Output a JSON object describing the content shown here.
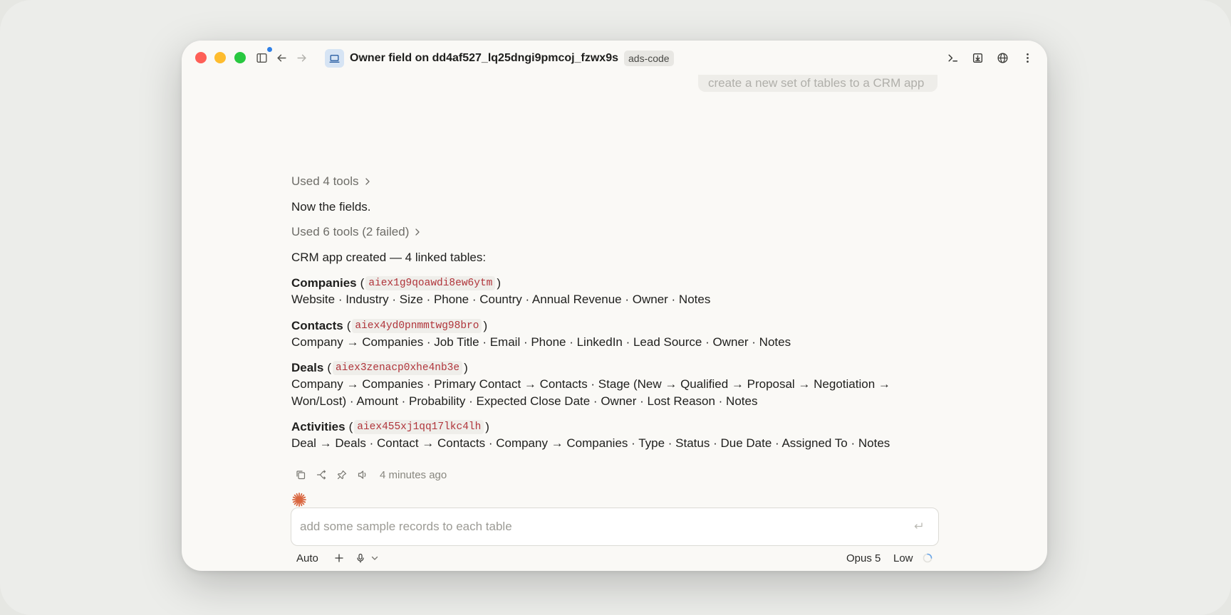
{
  "window": {
    "title": "Owner field on dd4af527_lq25dngi9pmcoj_fzwx9s",
    "badge": "ads-code"
  },
  "conversation": {
    "user_message": "create a new set of tables to a CRM app",
    "tools_used_1": "Used 4 tools",
    "line_fields": "Now the fields.",
    "tools_used_2": "Used 6 tools (2 failed)",
    "summary": "CRM app created — 4 linked tables:",
    "tables": [
      {
        "name": "Companies",
        "open": "(",
        "id": "aiex1g9qoawdi8ew6ytm",
        "close": ")",
        "fields": "Website · Industry · Size · Phone · Country · Annual Revenue · Owner · Notes"
      },
      {
        "name": "Contacts",
        "open": "(",
        "id": "aiex4yd0pnmmtwg98bro",
        "close": ")",
        "fields": "Company → Companies · Job Title · Email · Phone · LinkedIn · Lead Source · Owner · Notes"
      },
      {
        "name": "Deals",
        "open": "(",
        "id": "aiex3zenacp0xhe4nb3e",
        "close": ")",
        "fields": "Company → Companies · Primary Contact → Contacts · Stage (New → Qualified → Proposal → Negotiation → Won/Lost) · Amount · Probability · Expected Close Date · Owner · Lost Reason · Notes"
      },
      {
        "name": "Activities",
        "open": "(",
        "id": "aiex455xj1qq17lkc4lh",
        "close": ")",
        "fields": "Deal → Deals · Contact → Contacts · Company → Companies · Type · Status · Due Date · Assigned To · Notes"
      }
    ],
    "timestamp": "4 minutes ago"
  },
  "composer": {
    "placeholder": "add some sample records to each table",
    "mode": "Auto",
    "model": "Opus 5",
    "effort": "Low"
  },
  "icons": {
    "sidebar": "sidebar-icon",
    "back": "arrow-left-icon",
    "forward": "arrow-right-icon",
    "laptop": "laptop-icon",
    "terminal": "terminal-icon",
    "download": "download-icon",
    "globe": "globe-icon",
    "more": "more-vertical-icon",
    "copy": "copy-icon",
    "branch": "branch-icon",
    "pin": "pin-icon",
    "speaker": "speaker-icon",
    "spark": "spark-icon",
    "enter": "enter-icon",
    "plus": "plus-icon",
    "mic": "mic-icon",
    "chevron": "chevron-down-icon",
    "spinner": "spinner-icon"
  },
  "colors": {
    "accent_spark": "#d9663f",
    "code_text": "#b0343a",
    "badge_blue": "#2f7fe6"
  }
}
